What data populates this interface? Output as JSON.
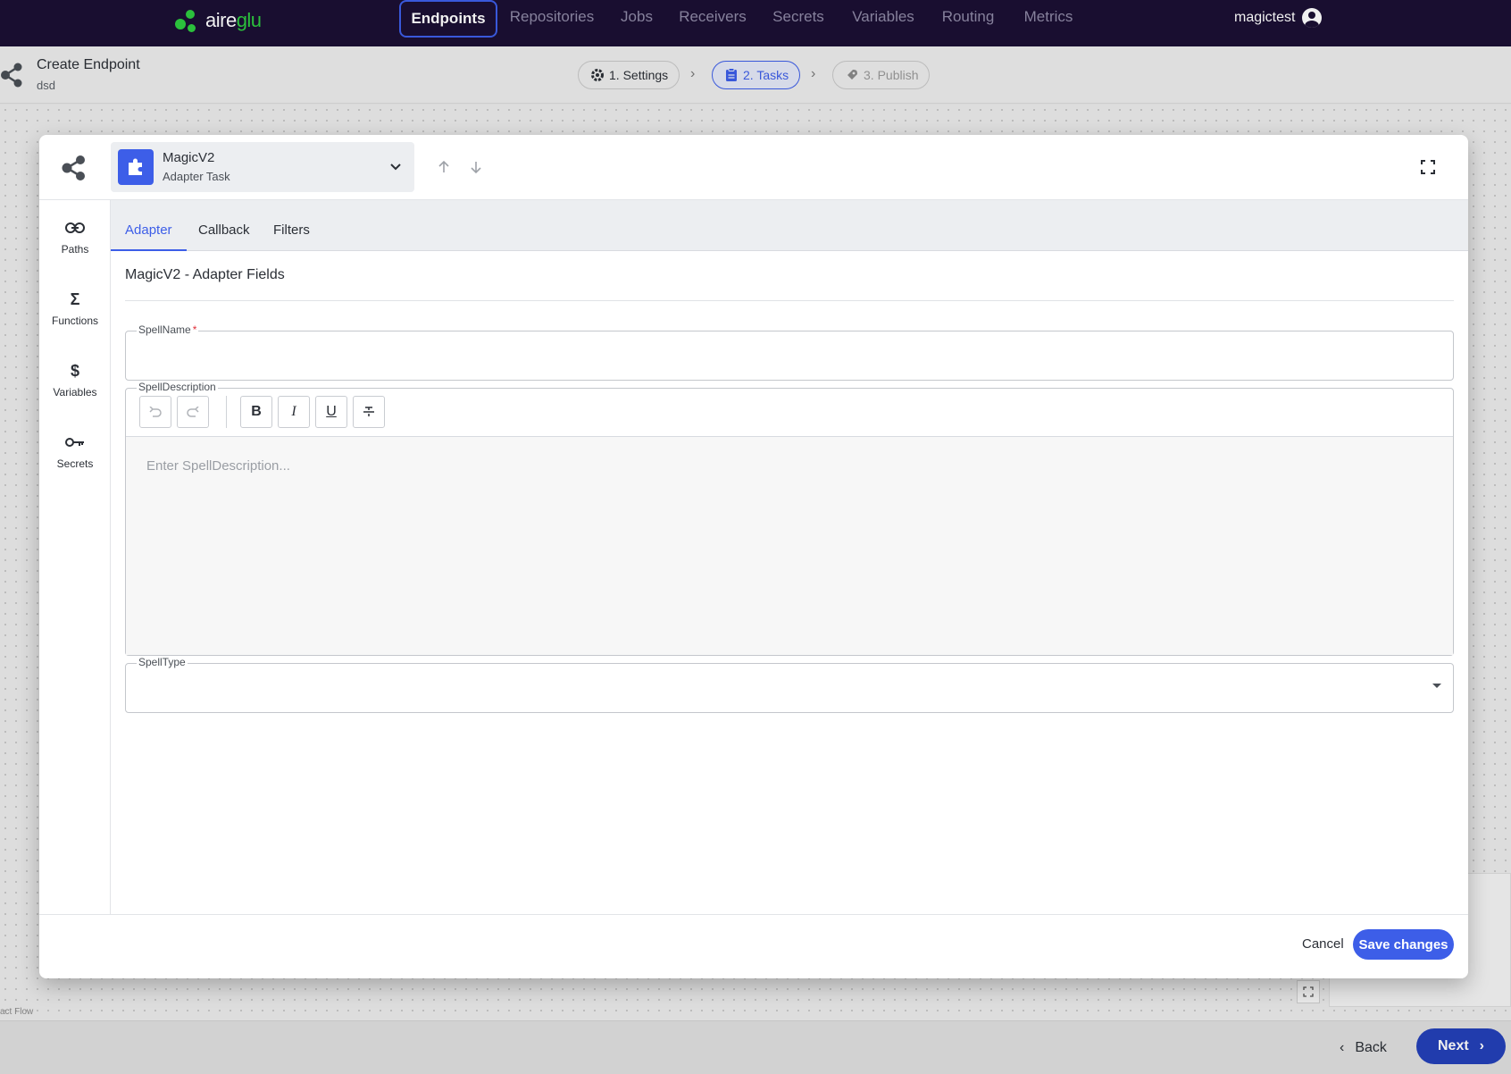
{
  "brand": {
    "name_part1": "aire",
    "name_part2": "glu",
    "accent": "#2ecc40"
  },
  "topnav": {
    "tabs": [
      {
        "label": "Endpoints",
        "active": true
      },
      {
        "label": "Repositories"
      },
      {
        "label": "Jobs"
      },
      {
        "label": "Receivers"
      },
      {
        "label": "Secrets"
      },
      {
        "label": "Variables"
      },
      {
        "label": "Routing"
      },
      {
        "label": "Metrics"
      }
    ],
    "user": "magictest",
    "user_icon": "account-circle-icon"
  },
  "subheader": {
    "title": "Create Endpoint",
    "subtitle": "dsd",
    "steps": [
      {
        "label": "1. Settings",
        "icon": "gear-icon",
        "state": "done"
      },
      {
        "label": "2. Tasks",
        "icon": "clipboard-icon",
        "state": "active"
      },
      {
        "label": "3. Publish",
        "icon": "rocket-icon",
        "state": "disabled"
      }
    ]
  },
  "canvas": {
    "attribution": "act Flow"
  },
  "bottombar": {
    "back_label": "Back",
    "next_label": "Next"
  },
  "modal": {
    "task": {
      "name": "MagicV2",
      "type": "Adapter Task",
      "icon": "puzzle-icon"
    },
    "side_nav": [
      {
        "label": "Paths",
        "icon": "link-icon"
      },
      {
        "label": "Functions",
        "icon": "sigma-icon"
      },
      {
        "label": "Variables",
        "icon": "dollar-icon"
      },
      {
        "label": "Secrets",
        "icon": "key-icon"
      }
    ],
    "tabs": [
      {
        "label": "Adapter",
        "active": true
      },
      {
        "label": "Callback"
      },
      {
        "label": "Filters"
      }
    ],
    "section_title": "MagicV2 - Adapter Fields",
    "fields": {
      "spell_name": {
        "label": "SpellName",
        "required_mark": "*",
        "value": ""
      },
      "spell_description": {
        "label": "SpellDescription",
        "placeholder": "Enter SpellDescription...",
        "value": ""
      },
      "spell_type": {
        "label": "SpellType",
        "value": ""
      }
    },
    "toolbar": {
      "bold": "B",
      "italic": "I",
      "underline": "U"
    },
    "footer": {
      "cancel_label": "Cancel",
      "save_label": "Save changes"
    }
  },
  "colors": {
    "primary": "#3d5ee8",
    "nav_bg": "#1b0f33"
  }
}
